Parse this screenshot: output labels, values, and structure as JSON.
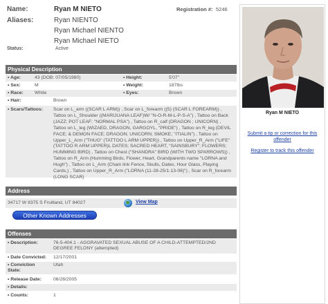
{
  "header": {
    "name_label": "Name:",
    "name_value": "Ryan M NIETO",
    "registration_label": "Registration #:",
    "registration_value": "5246",
    "aliases_label": "Aliases:",
    "aliases": [
      "Ryan NIENTO",
      "Ryan Michael NIENTO",
      "Ryan Michael NIETO"
    ],
    "status_label": "Status:",
    "status_value": "Active"
  },
  "physical": {
    "section_title": "Physical Description",
    "age_label": "• Age:",
    "age_value": "43  (DOB: 07/05/1980)",
    "height_label": "• Height:",
    "height_value": "5'07\"",
    "sex_label": "• Sex:",
    "sex_value": "M",
    "weight_label": "• Weight:",
    "weight_value": "187lbs",
    "race_label": "• Race:",
    "race_value": "White",
    "eyes_label": "• Eyes:",
    "eyes_value": "Brown",
    "hair_label": "• Hair:",
    "hair_value": "Brown",
    "scars_label": "• Scars/Tattoos:",
    "scars_value": "Scar on L_arm ((SCAR L ARM)) , Scar on L_forearm ((5) (SCAR L FOREARM)) , Tattoo on L_Shoulder ((MARIJUANA LEAF)W/ \"N-O-R-M-L-P-S-A\") , Tattoo on Back (JAZZ; POT LEAF; \"NORMAL PSA\") , Tattoo on R_calf (DRAGON ; UNICORN) , Tattoo on L_leg (WIZAED, DRAGON, GARGOYL, \"PRIDE\") , Tattoo on R_leg (DEVIL FACE; & DEMON FACE; DRAGON; UNICORN; SMOKE; \"ITIALIN\") , Tattoo on Upper_L_Arm (\"THUG\" (TATTOO L ARM UPPER)) , Tattoo on Upper_R_Arm (\"LIFE\" (TATTOO R ARM UPPER)L DATES; SACRED HEART, \"SAINSBURY\"; FLOWERS; HUMMING BIRD) , Tattoo on Chest (\"SHANDRA\" BIRD (WITH TWO SPARROWS)) , Tattoo on R_Arm (Humming Birds, Flower, Heart, Grandparents name \"LORNA and Hugh\") , Tattoo on L_Arm (Chain link Fence, Skulls, Dates, Hour Glass, Playing Cards,) , Tattoo on Upper_R_Arm (\"LORNA (11-28-25/1-13-06)\") , Scar on R_forearm (LONG SCAR)"
  },
  "address": {
    "section_title": "Address",
    "line": "34717 W 8375 S Fruitland, UT 84027",
    "view_map_label": "View Map",
    "other_button_label": "Other Known Addresses"
  },
  "offenses": {
    "section_title": "Offenses",
    "description_label": "• Description:",
    "description_value": "76-5-404.1 - AGGRAVATED SEXUAL ABUSE OF A CHILD-ATTEMPTED/2ND DEGREE FELONY (attempted)",
    "date_convicted_label": "• Date Convicted:",
    "date_convicted_value": "12/17/2001",
    "conviction_state_label": "• Conviction State:",
    "conviction_state_value": "Utah",
    "release_date_label": "• Release Date:",
    "release_date_value": "06/28/2005",
    "details_label": "• Details:",
    "details_value": "",
    "counts_label": "• Counts:",
    "counts_value": "1"
  },
  "sidebar": {
    "caption": "Ryan M NIETO",
    "tip_link": "Submit a tip or correction for this offender",
    "track_link": "Register to track this offender"
  },
  "colors": {
    "section_bar": "#6b6b6b",
    "row_band": "#ebebeb",
    "link": "#1a3fa5",
    "button": "#1d3fb5"
  }
}
